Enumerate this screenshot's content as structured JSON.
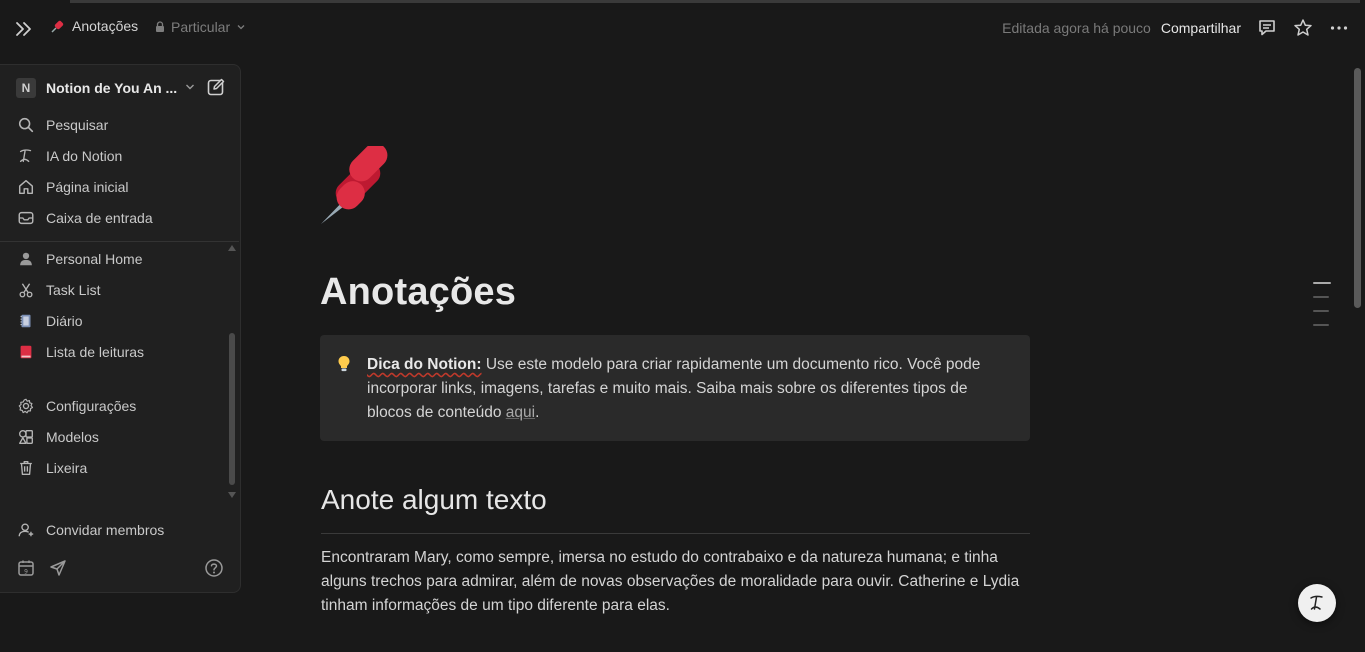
{
  "topbar": {
    "page_title": "Anotações",
    "privacy_label": "Particular",
    "edited": "Editada agora há pouco",
    "share_label": "Compartilhar"
  },
  "sidebar": {
    "workspace_initial": "N",
    "workspace_name": "Notion de You An ...",
    "nav": [
      {
        "label": "Pesquisar",
        "icon": "search-icon"
      },
      {
        "label": "IA do Notion",
        "icon": "notion-ai-icon"
      },
      {
        "label": "Página inicial",
        "icon": "home-icon"
      },
      {
        "label": "Caixa de entrada",
        "icon": "inbox-icon"
      }
    ],
    "pages": [
      {
        "label": "Personal Home",
        "icon": "person-icon"
      },
      {
        "label": "Task List",
        "icon": "scissors-icon"
      },
      {
        "label": "Diário",
        "icon": "notebook-icon"
      },
      {
        "label": "Lista de leituras",
        "icon": "red-book-icon"
      }
    ],
    "tools": [
      {
        "label": "Configurações",
        "icon": "gear-icon"
      },
      {
        "label": "Modelos",
        "icon": "templates-icon"
      },
      {
        "label": "Lixeira",
        "icon": "trash-icon"
      }
    ],
    "invite_label": "Convidar membros"
  },
  "main": {
    "title": "Anotações",
    "callout": {
      "bold": "Dica do Notion:",
      "text": " Use este modelo para criar rapidamente um documento rico. Você pode incorporar links, imagens, tarefas e muito mais. Saiba mais sobre os diferentes tipos de blocos de conteúdo ",
      "link": "aqui",
      "end": "."
    },
    "heading": "Anote algum texto",
    "paragraph": "Encontraram Mary, como sempre, imersa no estudo do contrabaixo e da natureza humana; e tinha alguns trechos para admirar, além de novas observações de moralidade para ouvir. Catherine e Lydia tinham informações de um tipo diferente para elas."
  },
  "colors": {
    "background": "#191919",
    "sidebar": "#202020",
    "callout": "#2a2a2a",
    "pin_red": "#dd2e44"
  }
}
